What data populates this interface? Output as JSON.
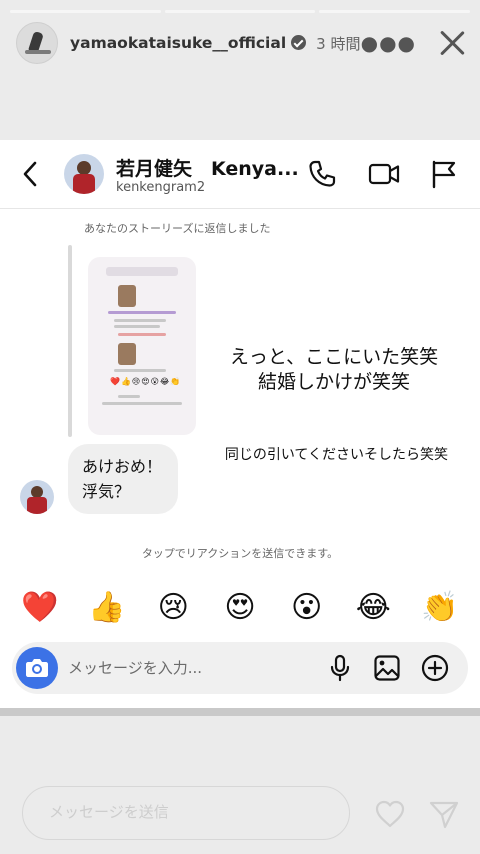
{
  "story": {
    "username": "yamaokataisuke__official",
    "time": "3 時間",
    "reply_placeholder": "メッセージを送信"
  },
  "dm": {
    "contact_name": "若月健矢　Kenya...",
    "contact_handle": "kenkengram2",
    "story_reply_note": "あなたのストーリーズに返信しました",
    "outgoing_story_text_line1": "えっと、ここにいた笑笑",
    "outgoing_story_text_line2": "結婚しかけが笑笑",
    "outgoing_text": "同じの引いてくださいそしたら笑笑",
    "incoming_line1": "あけおめ！",
    "incoming_line2": "浮気？",
    "reaction_hint": "タップでリアクションを送信できます。",
    "reactions": [
      "❤️",
      "👍",
      "😢",
      "😍",
      "😮",
      "😂",
      "👏"
    ],
    "composer_placeholder": "メッセージを入力..."
  },
  "colors": {
    "camera_button": "#3c72e6",
    "incoming_bubble": "#efefef",
    "story_background": "#ebebeb"
  }
}
